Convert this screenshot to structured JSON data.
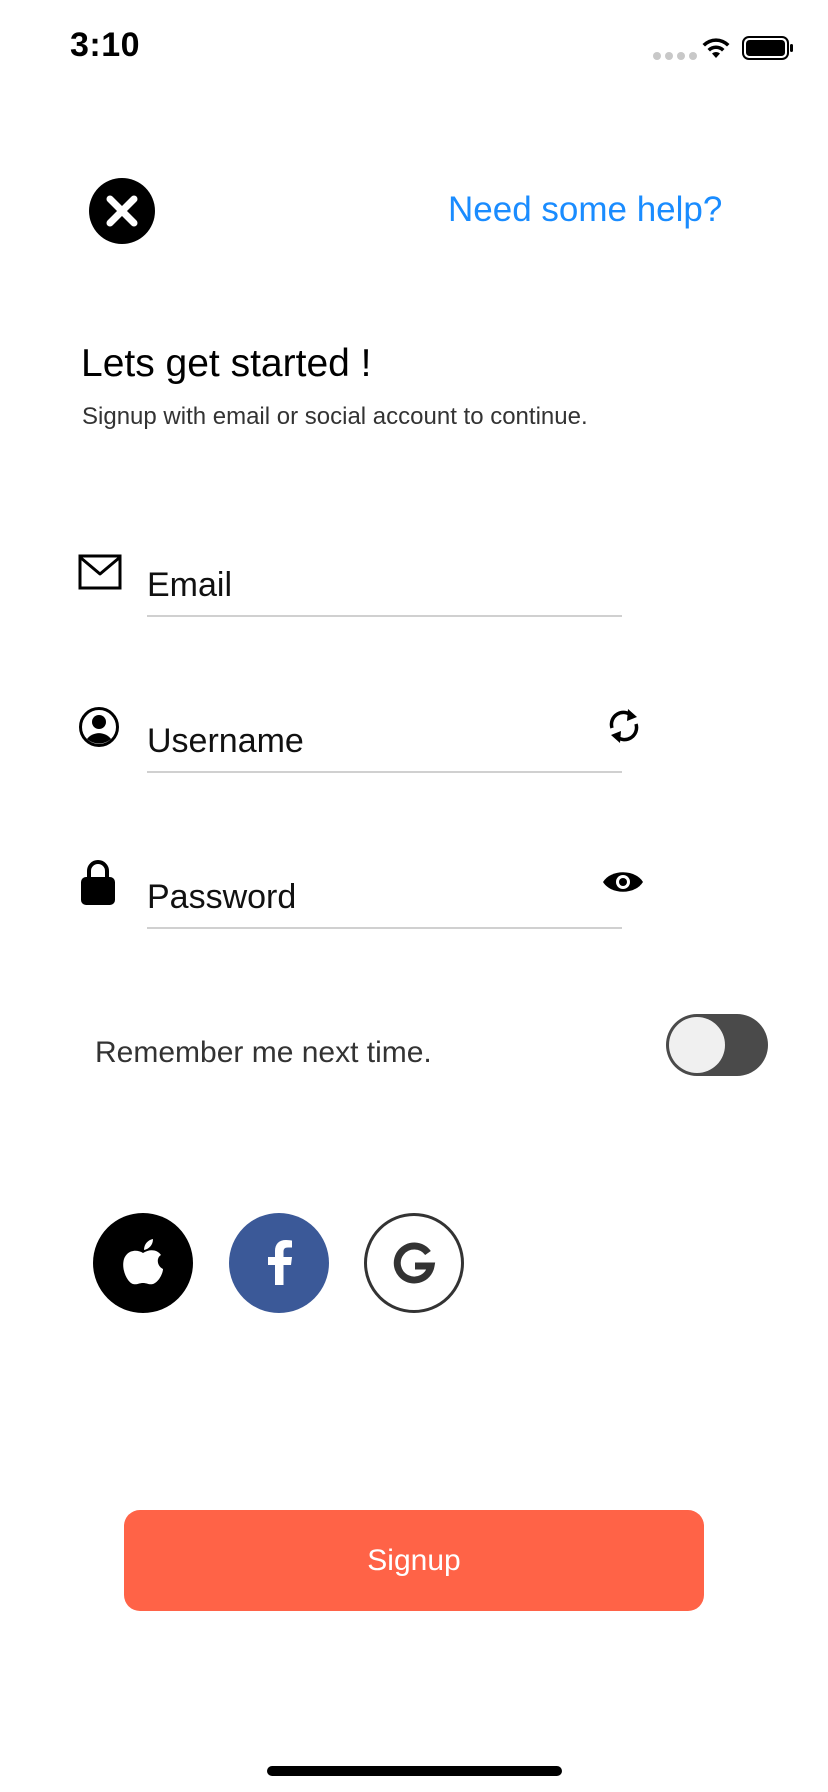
{
  "status_bar": {
    "time": "3:10"
  },
  "header": {
    "close_icon": "close-icon",
    "help_link": "Need some help?"
  },
  "intro": {
    "title": "Lets get started !",
    "subtitle": "Signup with email or social account to continue."
  },
  "form": {
    "email": {
      "placeholder": "Email",
      "value": "",
      "icon": "envelope-icon"
    },
    "username": {
      "placeholder": "Username",
      "value": "",
      "icon": "user-circle-icon",
      "action_icon": "refresh-icon"
    },
    "password": {
      "placeholder": "Password",
      "value": "",
      "icon": "lock-icon",
      "action_icon": "eye-icon"
    },
    "remember": {
      "label": "Remember me next time.",
      "checked": false
    }
  },
  "social": [
    {
      "name": "apple",
      "icon": "apple-icon",
      "color": "#000000"
    },
    {
      "name": "facebook",
      "icon": "facebook-icon",
      "color": "#3b5998"
    },
    {
      "name": "google",
      "icon": "google-icon",
      "color": "#ffffff"
    }
  ],
  "actions": {
    "signup_label": "Signup"
  },
  "colors": {
    "accent": "#ff6347",
    "link": "#1a8cff",
    "toggle_track": "#4a4a4a"
  }
}
